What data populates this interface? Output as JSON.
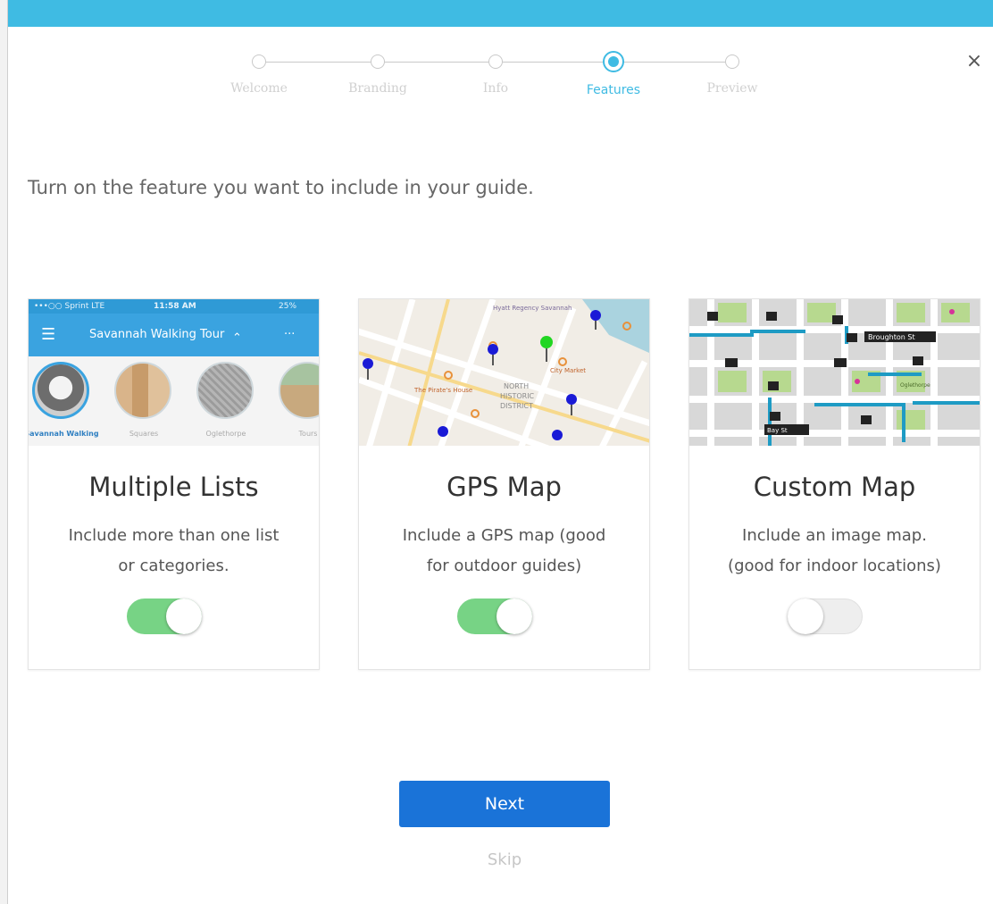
{
  "window": {
    "close_glyph": "×"
  },
  "stepper": {
    "steps": [
      {
        "label": "Welcome",
        "state": "done"
      },
      {
        "label": "Branding",
        "state": "done"
      },
      {
        "label": "Info",
        "state": "done"
      },
      {
        "label": "Features",
        "state": "active"
      },
      {
        "label": "Preview",
        "state": "upcoming"
      }
    ],
    "accent_color": "#3fbbe3"
  },
  "heading": "Turn on the feature you want to include in your guide.",
  "cards": [
    {
      "title": "Multiple Lists",
      "description_line1": "Include more than one list",
      "description_line2": "or categories.",
      "enabled": true,
      "preview": {
        "status_carrier": "•••○○ Sprint  LTE",
        "status_time": "11:58 AM",
        "status_battery": "25%",
        "app_title": "Savannah Walking Tour",
        "menu_glyph": "☰",
        "more_glyph": "···",
        "chevron_glyph": "⌃",
        "list_items": [
          "Savannah Walking",
          "Squares",
          "Oglethorpe",
          "Tours"
        ]
      }
    },
    {
      "title": "GPS Map",
      "description_line1": "Include a GPS map (good",
      "description_line2": "for outdoor guides)",
      "enabled": true,
      "preview": {
        "map_labels": [
          "Hyatt Regency Savannah",
          "NORTH",
          "HISTORIC",
          "DISTRICT",
          "The Pirate's House",
          "City Market"
        ]
      }
    },
    {
      "title": "Custom Map",
      "description_line1": "Include an image map.",
      "description_line2": "(good for indoor locations)",
      "enabled": false,
      "preview": {
        "map_labels": [
          "Bay St",
          "Broughton St",
          "Oglethorpe"
        ]
      }
    }
  ],
  "actions": {
    "next_label": "Next",
    "skip_label": "Skip"
  },
  "colors": {
    "top_bar": "#3fbbe3",
    "toggle_on": "#77d385",
    "primary_button": "#1a73d8"
  }
}
